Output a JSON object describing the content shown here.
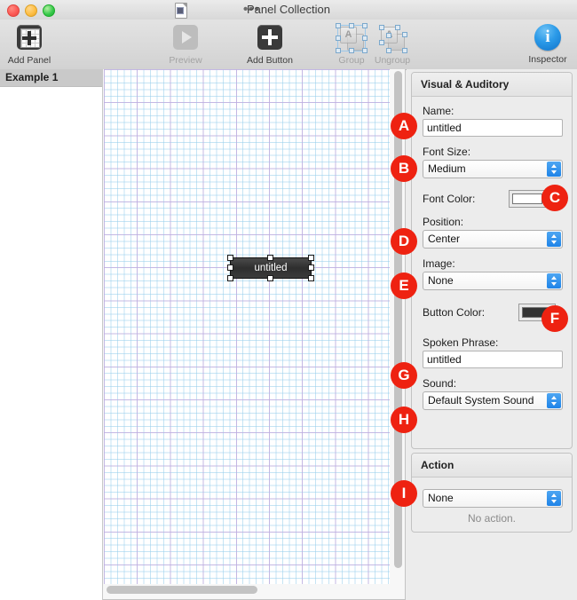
{
  "window": {
    "title": "Panel Collection",
    "traffic_lights": [
      "close",
      "minimize",
      "zoom"
    ],
    "doc_icon": "document-icon",
    "overflow": "•••"
  },
  "toolbar": {
    "items": [
      {
        "id": "add-panel",
        "label": "Add Panel",
        "icon": "add-panel-icon",
        "disabled": false
      },
      {
        "id": "preview",
        "label": "Preview",
        "icon": "play-icon",
        "disabled": true
      },
      {
        "id": "add-button",
        "label": "Add Button",
        "icon": "plus-icon",
        "disabled": false
      },
      {
        "id": "group",
        "label": "Group",
        "icon": "group-icon",
        "disabled": true
      },
      {
        "id": "ungroup",
        "label": "Ungroup",
        "icon": "ungroup-icon",
        "disabled": true
      },
      {
        "id": "inspector",
        "label": "Inspector",
        "icon": "info-icon",
        "disabled": false
      }
    ]
  },
  "sidebar": {
    "items": [
      {
        "label": "Example 1",
        "selected": true
      }
    ]
  },
  "canvas": {
    "button": {
      "label": "untitled",
      "selected": true
    },
    "grid": {
      "minor_color": "#96cdeb",
      "major_color": "#c4aade"
    }
  },
  "inspector": {
    "visual_auditory": {
      "header": "Visual & Auditory",
      "name": {
        "label": "Name:",
        "value": "untitled"
      },
      "font_size": {
        "label": "Font Size:",
        "value": "Medium"
      },
      "font_color": {
        "label": "Font Color:",
        "value": "#ffffff"
      },
      "position": {
        "label": "Position:",
        "value": "Center"
      },
      "image": {
        "label": "Image:",
        "value": "None"
      },
      "button_color": {
        "label": "Button Color:",
        "value": "#333333"
      },
      "spoken_phrase": {
        "label": "Spoken Phrase:",
        "value": "untitled"
      },
      "sound": {
        "label": "Sound:",
        "value": "Default System Sound"
      }
    },
    "action": {
      "header": "Action",
      "value": "None",
      "status": "No action."
    }
  },
  "annotations": {
    "accent_color": "#ee2211",
    "badges": [
      {
        "letter": "A",
        "target": "name-input"
      },
      {
        "letter": "B",
        "target": "font-size-select"
      },
      {
        "letter": "C",
        "target": "font-color-swatch"
      },
      {
        "letter": "D",
        "target": "position-select"
      },
      {
        "letter": "E",
        "target": "image-select"
      },
      {
        "letter": "F",
        "target": "button-color-swatch"
      },
      {
        "letter": "G",
        "target": "spoken-phrase-input"
      },
      {
        "letter": "H",
        "target": "sound-select"
      },
      {
        "letter": "I",
        "target": "action-select"
      }
    ]
  }
}
